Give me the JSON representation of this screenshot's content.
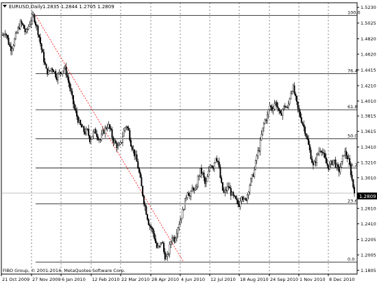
{
  "header": {
    "triangle_icon": "triangle-down-icon",
    "symbol": "EURUSD,Daily",
    "ohlc": "1.2835 1.2844 1.2705 1.2809"
  },
  "current_price": "1.2809",
  "watermark": "FIBO Group, © 2001-2014, MetaQuotes Software Corp.",
  "colors": {
    "background": "#ffffff",
    "grid": "#000000",
    "candle": "#000000",
    "fib_line": "#000000",
    "trend_line": "#ff0000",
    "price_tag_bg": "#000000",
    "price_tag_text": "#ffffff"
  },
  "chart_data": {
    "type": "candlestick",
    "symbol": "EURUSD",
    "timeframe": "Daily",
    "price_ticks": [
      "1.5230",
      "1.5025",
      "1.4820",
      "1.4620",
      "1.4415",
      "1.4210",
      "1.4010",
      "1.3815",
      "1.3615",
      "1.3410",
      "1.3210",
      "1.3010",
      "1.2809",
      "1.2610",
      "1.2410",
      "1.2205",
      "1.2005",
      "1.1805"
    ],
    "date_ticks": [
      "21 Oct 2009",
      "27 Nov 2009",
      "6 Jan 2010",
      "12 Feb 2010",
      "22 Mar 2010",
      "28 Apr 2010",
      "4 Jun 2010",
      "12 Jul 2010",
      "18 Aug 2010",
      "24 Sep 2010",
      "1 Nov 2010",
      "8 Dec 2010"
    ],
    "fibonacci": [
      {
        "level": "100.0",
        "price": 1.5124
      },
      {
        "level": "76.4",
        "price": 1.4365
      },
      {
        "level": "61.8",
        "price": 1.3896
      },
      {
        "level": "50.0",
        "price": 1.3517
      },
      {
        "level": "38.2",
        "price": 1.3138
      },
      {
        "level": "23.6",
        "price": 1.2669
      },
      {
        "level": "0.0",
        "price": 1.191
      }
    ],
    "ylim": [
      1.1755,
      1.529
    ],
    "series_close": [
      1.487,
      1.492,
      1.48,
      1.469,
      1.474,
      1.485,
      1.495,
      1.503,
      1.498,
      1.489,
      1.498,
      1.507,
      1.512,
      1.5,
      1.488,
      1.47,
      1.455,
      1.44,
      1.438,
      1.445,
      1.44,
      1.432,
      1.437,
      1.44,
      1.445,
      1.435,
      1.42,
      1.405,
      1.39,
      1.38,
      1.37,
      1.365,
      1.36,
      1.362,
      1.35,
      1.358,
      1.362,
      1.355,
      1.35,
      1.36,
      1.365,
      1.37,
      1.362,
      1.35,
      1.345,
      1.34,
      1.345,
      1.36,
      1.37,
      1.362,
      1.345,
      1.335,
      1.325,
      1.31,
      1.29,
      1.27,
      1.255,
      1.24,
      1.235,
      1.225,
      1.21,
      1.21,
      1.22,
      1.2,
      1.195,
      1.21,
      1.225,
      1.22,
      1.235,
      1.245,
      1.255,
      1.27,
      1.285,
      1.275,
      1.29,
      1.28,
      1.3,
      1.31,
      1.305,
      1.29,
      1.305,
      1.32,
      1.315,
      1.33,
      1.32,
      1.295,
      1.28,
      1.285,
      1.29,
      1.28,
      1.275,
      1.27,
      1.265,
      1.28,
      1.27,
      1.275,
      1.29,
      1.3,
      1.31,
      1.33,
      1.34,
      1.36,
      1.375,
      1.38,
      1.395,
      1.39,
      1.4,
      1.395,
      1.38,
      1.39,
      1.395,
      1.39,
      1.41,
      1.42,
      1.405,
      1.39,
      1.38,
      1.37,
      1.36,
      1.345,
      1.33,
      1.315,
      1.325,
      1.335,
      1.34,
      1.33,
      1.32,
      1.315,
      1.32,
      1.325,
      1.315,
      1.31,
      1.32,
      1.335,
      1.33,
      1.32,
      1.3,
      1.2809
    ]
  }
}
